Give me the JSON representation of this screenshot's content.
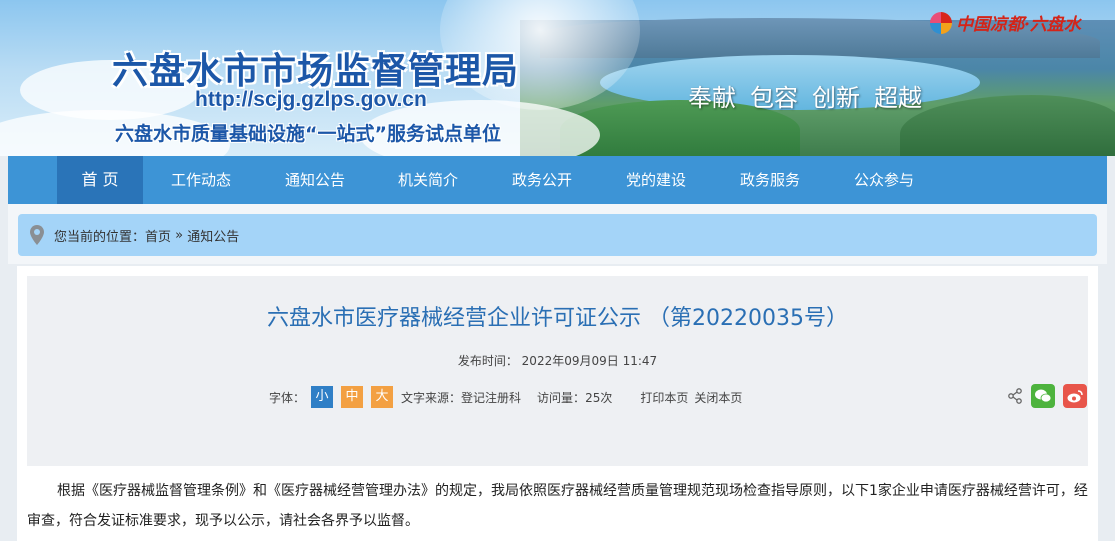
{
  "banner": {
    "site_title": "六盘水市市场监督管理局",
    "url": "http://scjg.gzlps.gov.cn",
    "subtitle": "六盘水市质量基础设施“一站式”服务试点单位",
    "slogans": [
      "奉献",
      "包容",
      "创新",
      "超越"
    ],
    "brand_text": "中国凉都·六盘水"
  },
  "nav": {
    "items": [
      "首 页",
      "工作动态",
      "通知公告",
      "机关简介",
      "政务公开",
      "党的建设",
      "政务服务",
      "公众参与"
    ],
    "active_index": 0
  },
  "breadcrumb": {
    "prefix": "您当前的位置：",
    "home": "首页",
    "sep": " » ",
    "current": "通知公告"
  },
  "article": {
    "title": "六盘水市医疗器械经营企业许可证公示 （第20220035号）",
    "published_label": "发布时间：",
    "published": "2022年09月09日 11:47",
    "font_label": "字体：",
    "font_small": "小",
    "font_mid": "中",
    "font_big": "大",
    "source_label": "文字来源：",
    "source": "登记注册科",
    "visits_label": "访问量：",
    "visits": "25次",
    "print": "打印本页",
    "close": "关闭本页",
    "body": "根据《医疗器械监督管理条例》和《医疗器械经营管理办法》的规定，我局依照医疗器械经营质量管理规范现场检查指导原则，以下1家企业申请医疗器械经营许可，经审查，符合发证标准要求，现予以公示，请社会各界予以监督。"
  },
  "colors": {
    "nav_bg": "#3d94d6",
    "nav_active": "#2a74b8",
    "title_blue": "#2a6fb4",
    "crumb_bg": "#a4d4f8"
  },
  "icons": [
    "location-pin-icon",
    "share-icon",
    "wechat-icon",
    "weibo-icon"
  ]
}
